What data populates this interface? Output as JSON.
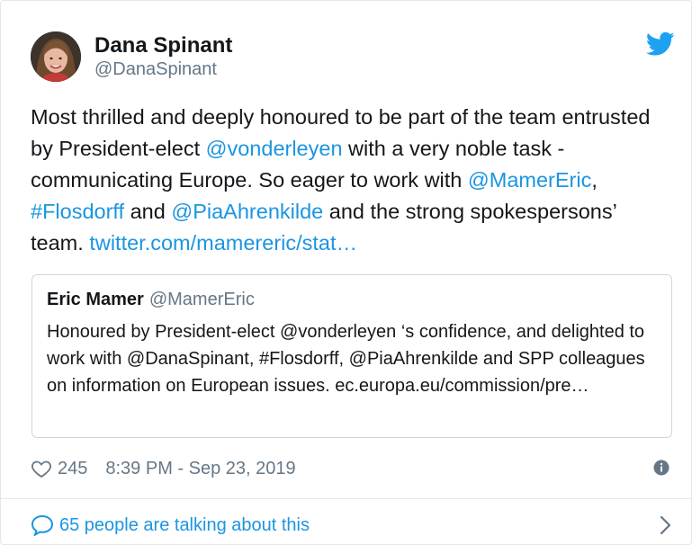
{
  "author": {
    "name": "Dana Spinant",
    "handle": "@DanaSpinant"
  },
  "tweet": {
    "segments": [
      {
        "text": "Most thrilled and deeply honoured to be part of the team entrusted by President-elect ",
        "type": "text"
      },
      {
        "text": "@vonderleyen",
        "type": "link"
      },
      {
        "text": " with a very noble task - communicating Europe. So eager to work with ",
        "type": "text"
      },
      {
        "text": "@MamerEric",
        "type": "link"
      },
      {
        "text": ", ",
        "type": "text"
      },
      {
        "text": "#Flosdorff",
        "type": "link"
      },
      {
        "text": " and ",
        "type": "text"
      },
      {
        "text": "@PiaAhrenkilde",
        "type": "link"
      },
      {
        "text": " and the strong spokespersons’ team. ",
        "type": "text"
      },
      {
        "text": "twitter.com/mamereric/stat…",
        "type": "link"
      }
    ]
  },
  "quoted": {
    "name": "Eric Mamer",
    "handle": "@MamerEric",
    "text": "Honoured by President-elect @vonderleyen ‘s confidence, and delighted to work with @DanaSpinant, #Flosdorff, @PiaAhrenkilde and SPP colleagues on information on European issues. ec.europa.eu/commission/pre…"
  },
  "meta": {
    "likes": "245",
    "timestamp": "8:39 PM - Sep 23, 2019"
  },
  "footer": {
    "talking": "65 people are talking about this"
  },
  "icons": {
    "bird": "twitter-bird-icon",
    "heart": "heart-icon",
    "info": "info-icon",
    "bubble": "speech-bubble-icon",
    "chevron": "chevron-right-icon"
  },
  "colors": {
    "link": "#1b95e0",
    "secondary": "#657786",
    "border": "#e1e8ed"
  }
}
